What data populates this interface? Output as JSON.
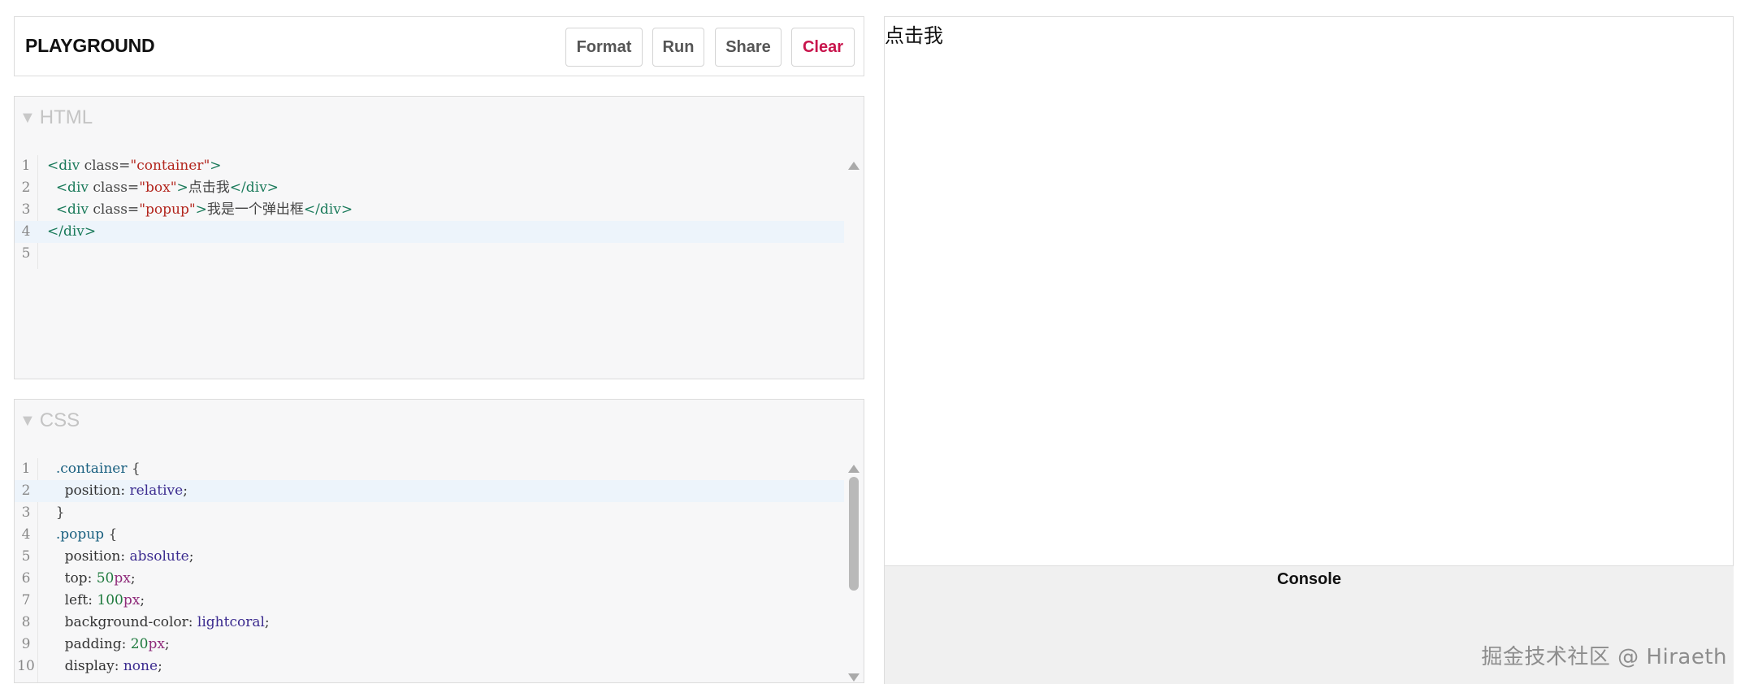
{
  "header": {
    "brand": "PLAYGROUND",
    "buttons": {
      "format": "Format",
      "run": "Run",
      "share": "Share",
      "clear": "Clear"
    },
    "clear_color": "#c8144c"
  },
  "html_panel": {
    "title": "HTML",
    "caret": "▼",
    "lines": [
      {
        "n": "1",
        "parts": [
          [
            "tag",
            "<div "
          ],
          [
            "attr",
            "class="
          ],
          [
            "str",
            "\"container\""
          ],
          [
            "tag",
            ">"
          ]
        ]
      },
      {
        "n": "2",
        "parts": [
          [
            "attr",
            "  "
          ],
          [
            "tag",
            "<div "
          ],
          [
            "attr",
            "class="
          ],
          [
            "str",
            "\"box\""
          ],
          [
            "tag",
            ">"
          ],
          [
            "attr",
            "点击我"
          ],
          [
            "tag",
            "</div>"
          ]
        ]
      },
      {
        "n": "3",
        "parts": [
          [
            "attr",
            "  "
          ],
          [
            "tag",
            "<div "
          ],
          [
            "attr",
            "class="
          ],
          [
            "str",
            "\"popup\""
          ],
          [
            "tag",
            ">"
          ],
          [
            "attr",
            "我是一个弹出框"
          ],
          [
            "tag",
            "</div>"
          ]
        ]
      },
      {
        "n": "4",
        "parts": [
          [
            "tag",
            "</div>"
          ]
        ],
        "active": true
      },
      {
        "n": "5",
        "parts": []
      }
    ]
  },
  "css_panel": {
    "title": "CSS",
    "caret": "▼",
    "lines": [
      {
        "n": "1",
        "parts": [
          [
            "attr",
            "  "
          ],
          [
            "sel",
            ".container"
          ],
          [
            "attr",
            " {"
          ]
        ]
      },
      {
        "n": "2",
        "parts": [
          [
            "prop",
            "    position: "
          ],
          [
            "val",
            "relative"
          ],
          [
            "prop",
            ";"
          ]
        ],
        "active": true
      },
      {
        "n": "3",
        "parts": [
          [
            "attr",
            "  }"
          ]
        ]
      },
      {
        "n": "4",
        "parts": [
          [
            "attr",
            "  "
          ],
          [
            "sel",
            ".popup"
          ],
          [
            "attr",
            " {"
          ]
        ]
      },
      {
        "n": "5",
        "parts": [
          [
            "prop",
            "    position: "
          ],
          [
            "val",
            "absolute"
          ],
          [
            "prop",
            ";"
          ]
        ]
      },
      {
        "n": "6",
        "parts": [
          [
            "prop",
            "    top: "
          ],
          [
            "num",
            "50"
          ],
          [
            "unit",
            "px"
          ],
          [
            "prop",
            ";"
          ]
        ]
      },
      {
        "n": "7",
        "parts": [
          [
            "prop",
            "    left: "
          ],
          [
            "num",
            "100"
          ],
          [
            "unit",
            "px"
          ],
          [
            "prop",
            ";"
          ]
        ]
      },
      {
        "n": "8",
        "parts": [
          [
            "prop",
            "    background-color: "
          ],
          [
            "val",
            "lightcoral"
          ],
          [
            "prop",
            ";"
          ]
        ]
      },
      {
        "n": "9",
        "parts": [
          [
            "prop",
            "    padding: "
          ],
          [
            "num",
            "20"
          ],
          [
            "unit",
            "px"
          ],
          [
            "prop",
            ";"
          ]
        ]
      },
      {
        "n": "10",
        "parts": [
          [
            "prop",
            "    display: "
          ],
          [
            "val",
            "none"
          ],
          [
            "prop",
            ";"
          ]
        ]
      }
    ]
  },
  "preview": {
    "text": "点击我"
  },
  "console": {
    "title": "Console"
  },
  "watermark": "掘金技术社区 @ Hiraeth"
}
